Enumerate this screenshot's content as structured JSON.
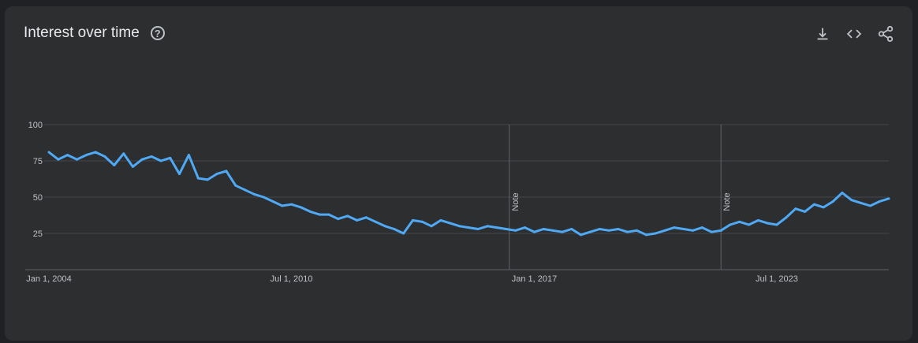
{
  "header": {
    "title": "Interest over time",
    "help_icon": "help-circle-icon"
  },
  "actions": [
    {
      "icon": "download-icon"
    },
    {
      "icon": "embed-code-icon"
    },
    {
      "icon": "share-icon"
    }
  ],
  "colors": {
    "line": "#4fa9f5",
    "grid": "#44464a",
    "background": "#2d2e30"
  },
  "chart_data": {
    "type": "line",
    "title": "Interest over time",
    "xlabel": "",
    "ylabel": "",
    "ylim": [
      0,
      100
    ],
    "yticks": [
      100,
      75,
      50,
      25
    ],
    "xticks": [
      {
        "x": "2004-01-01",
        "label": "Jan 1, 2004"
      },
      {
        "x": "2010-07-01",
        "label": "Jul 1, 2010"
      },
      {
        "x": "2017-01-01",
        "label": "Jan 1, 2017"
      },
      {
        "x": "2023-07-01",
        "label": "Jul 1, 2023"
      }
    ],
    "xlim": [
      "2004-01-01",
      "2026-07-01"
    ],
    "grid": true,
    "legend": "none",
    "annotations": [
      {
        "x": "2016-05-01",
        "text": "Note"
      },
      {
        "x": "2022-01-01",
        "text": "Note"
      }
    ],
    "series": [
      {
        "points": [
          [
            "2004-01-01",
            81
          ],
          [
            "2004-04-01",
            76
          ],
          [
            "2004-07-01",
            79
          ],
          [
            "2004-10-01",
            76
          ],
          [
            "2005-01-01",
            79
          ],
          [
            "2005-04-01",
            81
          ],
          [
            "2005-07-01",
            78
          ],
          [
            "2005-10-01",
            72
          ],
          [
            "2006-01-01",
            80
          ],
          [
            "2006-04-01",
            71
          ],
          [
            "2006-07-01",
            76
          ],
          [
            "2006-10-01",
            78
          ],
          [
            "2007-01-01",
            75
          ],
          [
            "2007-04-01",
            77
          ],
          [
            "2007-07-01",
            66
          ],
          [
            "2007-10-01",
            79
          ],
          [
            "2008-01-01",
            63
          ],
          [
            "2008-04-01",
            62
          ],
          [
            "2008-07-01",
            66
          ],
          [
            "2008-10-01",
            68
          ],
          [
            "2009-01-01",
            58
          ],
          [
            "2009-04-01",
            55
          ],
          [
            "2009-07-01",
            52
          ],
          [
            "2009-10-01",
            50
          ],
          [
            "2010-01-01",
            47
          ],
          [
            "2010-04-01",
            44
          ],
          [
            "2010-07-01",
            45
          ],
          [
            "2010-10-01",
            43
          ],
          [
            "2011-01-01",
            40
          ],
          [
            "2011-04-01",
            38
          ],
          [
            "2011-07-01",
            38
          ],
          [
            "2011-10-01",
            35
          ],
          [
            "2012-01-01",
            37
          ],
          [
            "2012-04-01",
            34
          ],
          [
            "2012-07-01",
            36
          ],
          [
            "2012-10-01",
            33
          ],
          [
            "2013-01-01",
            30
          ],
          [
            "2013-04-01",
            28
          ],
          [
            "2013-07-01",
            25
          ],
          [
            "2013-10-01",
            34
          ],
          [
            "2014-01-01",
            33
          ],
          [
            "2014-04-01",
            30
          ],
          [
            "2014-07-01",
            34
          ],
          [
            "2014-10-01",
            32
          ],
          [
            "2015-01-01",
            30
          ],
          [
            "2015-04-01",
            29
          ],
          [
            "2015-07-01",
            28
          ],
          [
            "2015-10-01",
            30
          ],
          [
            "2016-01-01",
            29
          ],
          [
            "2016-04-01",
            28
          ],
          [
            "2016-07-01",
            27
          ],
          [
            "2016-10-01",
            29
          ],
          [
            "2017-01-01",
            26
          ],
          [
            "2017-04-01",
            28
          ],
          [
            "2017-07-01",
            27
          ],
          [
            "2017-10-01",
            26
          ],
          [
            "2018-01-01",
            28
          ],
          [
            "2018-04-01",
            24
          ],
          [
            "2018-07-01",
            26
          ],
          [
            "2018-10-01",
            28
          ],
          [
            "2019-01-01",
            27
          ],
          [
            "2019-04-01",
            28
          ],
          [
            "2019-07-01",
            26
          ],
          [
            "2019-10-01",
            27
          ],
          [
            "2020-01-01",
            24
          ],
          [
            "2020-04-01",
            25
          ],
          [
            "2020-07-01",
            27
          ],
          [
            "2020-10-01",
            29
          ],
          [
            "2021-01-01",
            28
          ],
          [
            "2021-04-01",
            27
          ],
          [
            "2021-07-01",
            29
          ],
          [
            "2021-10-01",
            26
          ],
          [
            "2022-01-01",
            27
          ],
          [
            "2022-04-01",
            31
          ],
          [
            "2022-07-01",
            33
          ],
          [
            "2022-10-01",
            31
          ],
          [
            "2023-01-01",
            34
          ],
          [
            "2023-04-01",
            32
          ],
          [
            "2023-07-01",
            31
          ],
          [
            "2023-10-01",
            36
          ],
          [
            "2024-01-01",
            42
          ],
          [
            "2024-04-01",
            40
          ],
          [
            "2024-07-01",
            45
          ],
          [
            "2024-10-01",
            43
          ],
          [
            "2025-01-01",
            47
          ],
          [
            "2025-04-01",
            53
          ],
          [
            "2025-07-01",
            48
          ],
          [
            "2025-10-01",
            46
          ],
          [
            "2026-01-01",
            44
          ],
          [
            "2026-04-01",
            47
          ],
          [
            "2026-07-01",
            49
          ]
        ]
      }
    ]
  }
}
